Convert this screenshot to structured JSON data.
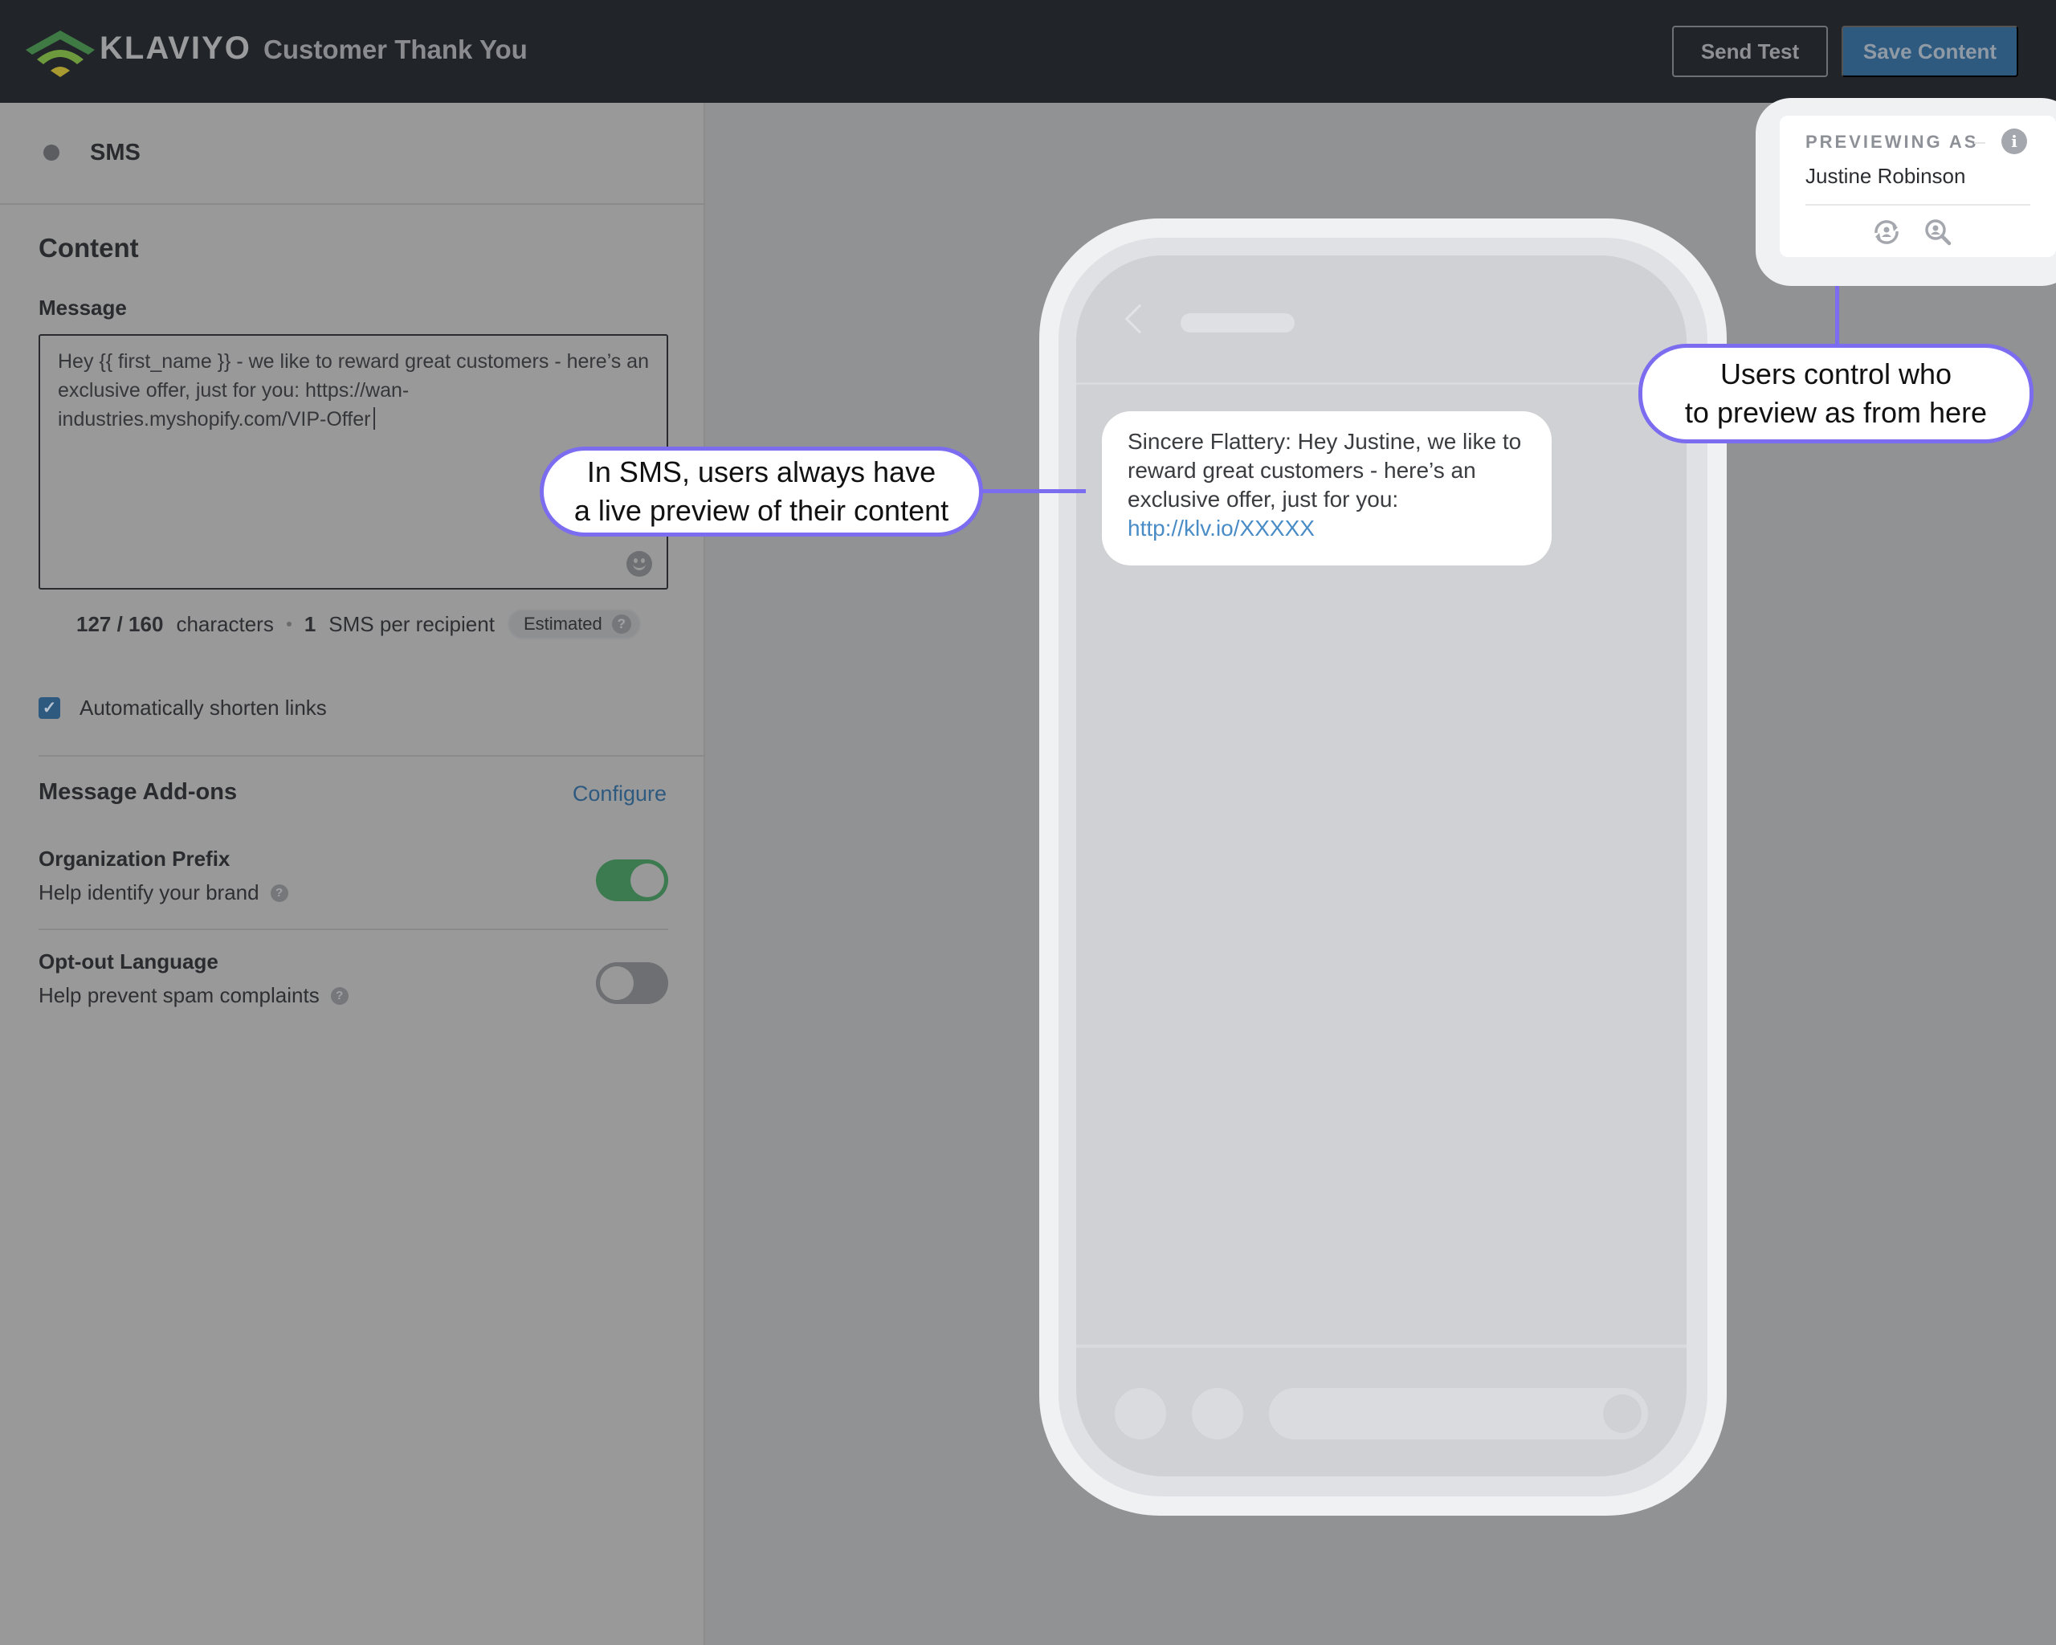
{
  "header": {
    "brand": "KLAVIYO",
    "title": "Customer Thank You",
    "send_test_label": "Send Test",
    "save_content_label": "Save Content"
  },
  "left_panel": {
    "channel_label": "SMS",
    "content_title": "Content",
    "message_label": "Message",
    "message_value": "Hey {{ first_name }} - we like to reward great customers - here’s an exclusive offer, just for you: https://wan-industries.myshopify.com/VIP-Offer",
    "counter": {
      "count": "127 / 160",
      "count_unit": "characters",
      "sms_count": "1",
      "sms_unit": "SMS per recipient",
      "badge": "Estimated",
      "help_glyph": "?"
    },
    "shorten_links": {
      "label": "Automatically shorten links",
      "checked": true,
      "check_glyph": "✓"
    },
    "addons": {
      "title": "Message Add-ons",
      "configure_label": "Configure",
      "items": [
        {
          "name": "Organization Prefix",
          "description": "Help identify your brand",
          "enabled": true,
          "help_glyph": "?"
        },
        {
          "name": "Opt-out Language",
          "description": "Help prevent spam complaints",
          "enabled": false,
          "help_glyph": "?"
        }
      ]
    }
  },
  "preview": {
    "bubble_text": "Sincere Flattery: Hey Justine, we like to reward great customers - here’s an exclusive offer, just for you:",
    "bubble_link": "http://klv.io/XXXXX",
    "previewing_as_label": "PREVIEWING AS",
    "previewing_as_name": "Justine Robinson",
    "info_glyph": "i"
  },
  "annotations": {
    "live_preview": [
      "In SMS, users always have",
      "a live preview of their content"
    ],
    "preview_as": [
      "Users control who",
      "to preview as from here"
    ]
  },
  "colors": {
    "accent_blue": "#2e5a80",
    "toggle_on": "#3c7a4f",
    "annotation_purple": "#7b6cf0",
    "link_blue": "#4a8cc6"
  }
}
